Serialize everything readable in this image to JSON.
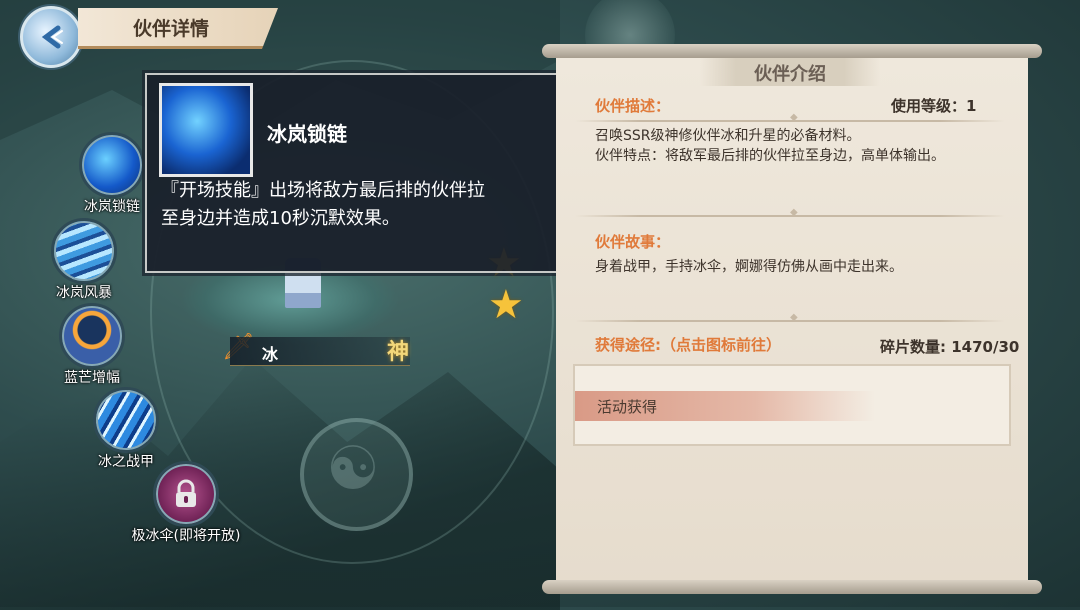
{
  "header": {
    "title": "伙伴详情"
  },
  "skills": [
    {
      "label": "冰岚锁链"
    },
    {
      "label": "冰岚风暴"
    },
    {
      "label": "蓝芒增幅"
    },
    {
      "label": "冰之战甲"
    },
    {
      "label": "极冰伞(即将开放)"
    }
  ],
  "character": {
    "name": "冰",
    "rank_badge": "神",
    "stars": 2
  },
  "tooltip": {
    "name": "冰岚锁链",
    "desc_line1": "『开场技能』出场将敌方最后排的伙伴拉",
    "desc_line2": "至身边并造成10秒沉默效果。"
  },
  "panel": {
    "title": "伙伴介绍",
    "desc_label": "伙伴描述：",
    "level_text": "使用等级：1",
    "desc_line1": "召唤SSR级神修伙伴冰和升星的必备材料。",
    "desc_line2": "伙伴特点：将敌军最后排的伙伴拉至身边，高单体输出。",
    "story_label": "伙伴故事：",
    "story_text": "身着战甲，手持冰伞，婀娜得仿佛从画中走出来。",
    "obtain_label": "获得途径:（点击图标前往）",
    "fragments_text": "碎片数量: 1470/30",
    "obtain_items": [
      "活动获得"
    ]
  }
}
